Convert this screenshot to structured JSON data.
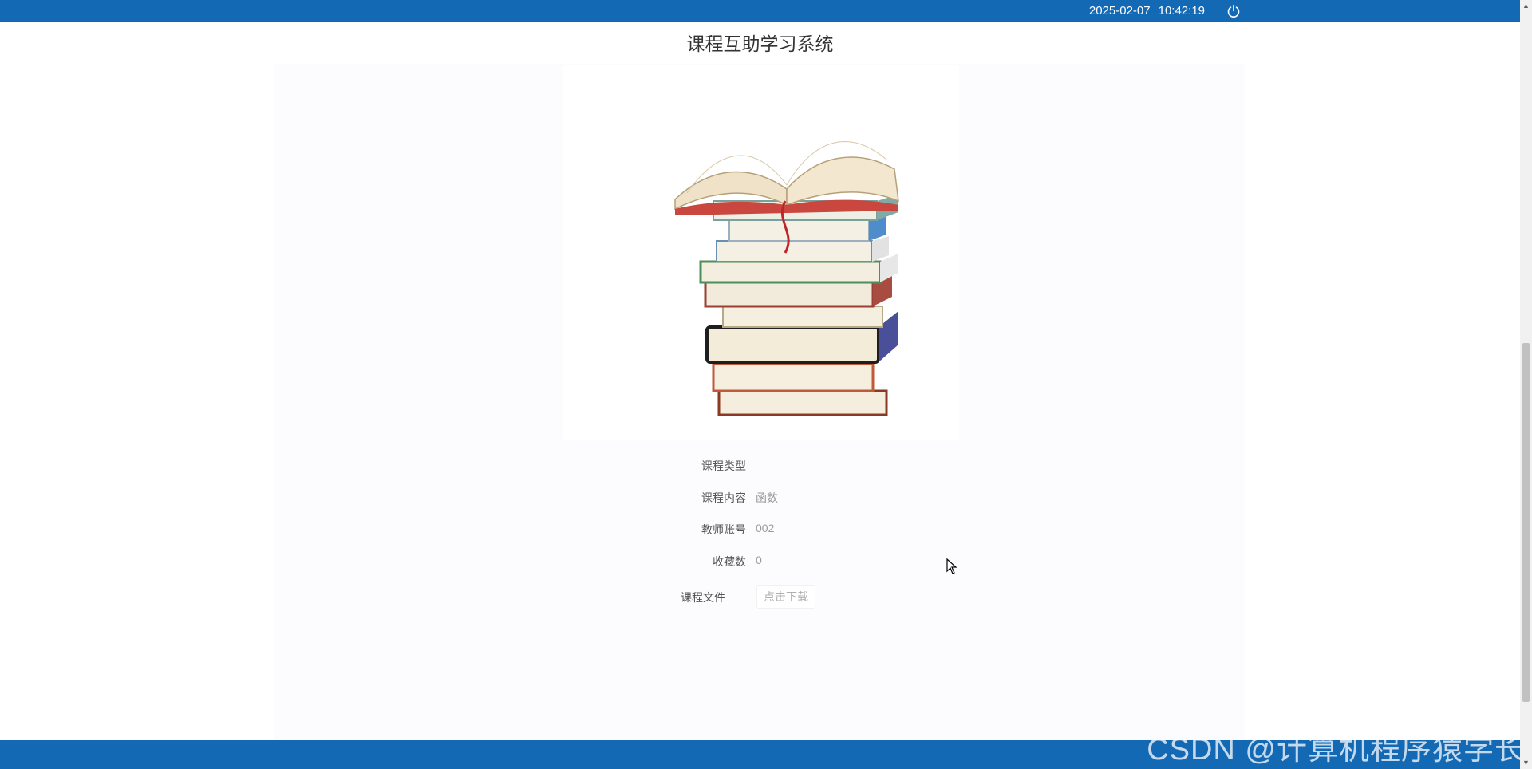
{
  "header": {
    "date": "2025-02-07",
    "time": "10:42:19",
    "power_icon": "power-icon",
    "background_color": "#1469b5"
  },
  "site_title": "课程互助学习系统",
  "course_image": "stack-of-books",
  "details": {
    "course_type": {
      "label": "课程类型",
      "value": ""
    },
    "course_content": {
      "label": "课程内容",
      "value": "函数"
    },
    "teacher_account": {
      "label": "教师账号",
      "value": "002"
    },
    "favorites": {
      "label": "收藏数",
      "value": "0"
    },
    "course_file": {
      "label": "课程文件",
      "button": "点击下载"
    }
  },
  "watermark": "CSDN @计算机程序猿学长"
}
